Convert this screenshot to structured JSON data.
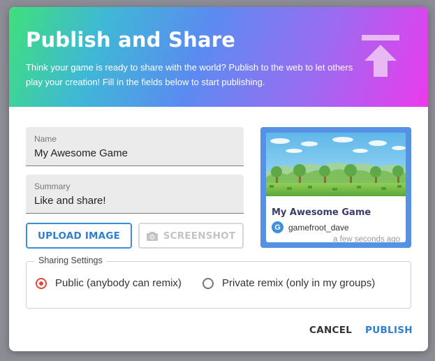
{
  "dialog": {
    "title": "Publish and Share",
    "description": "Think your game is ready to share with the world? Publish to the web to let others play your creation! Fill in the fields below to start publishing.",
    "icon": "publish-upload-icon"
  },
  "form": {
    "name_label": "Name",
    "name_value": "My Awesome Game",
    "summary_label": "Summary",
    "summary_value": "Like and share!"
  },
  "buttons": {
    "upload_label": "UPLOAD IMAGE",
    "screenshot_label": "SCREENSHOT",
    "cancel_label": "CANCEL",
    "publish_label": "PUBLISH"
  },
  "preview_card": {
    "title": "My Awesome Game",
    "avatar_letter": "G",
    "author": "gamefroot_dave",
    "time": "a few seconds ago"
  },
  "sharing": {
    "legend": "Sharing Settings",
    "options": [
      {
        "label": "Public (anybody can remix)",
        "selected": true
      },
      {
        "label": "Private remix (only in my groups)",
        "selected": false
      }
    ]
  },
  "colors": {
    "accent_blue": "#2f7fcf",
    "radio_selected": "#e2473b",
    "card_frame": "#5591e4"
  }
}
